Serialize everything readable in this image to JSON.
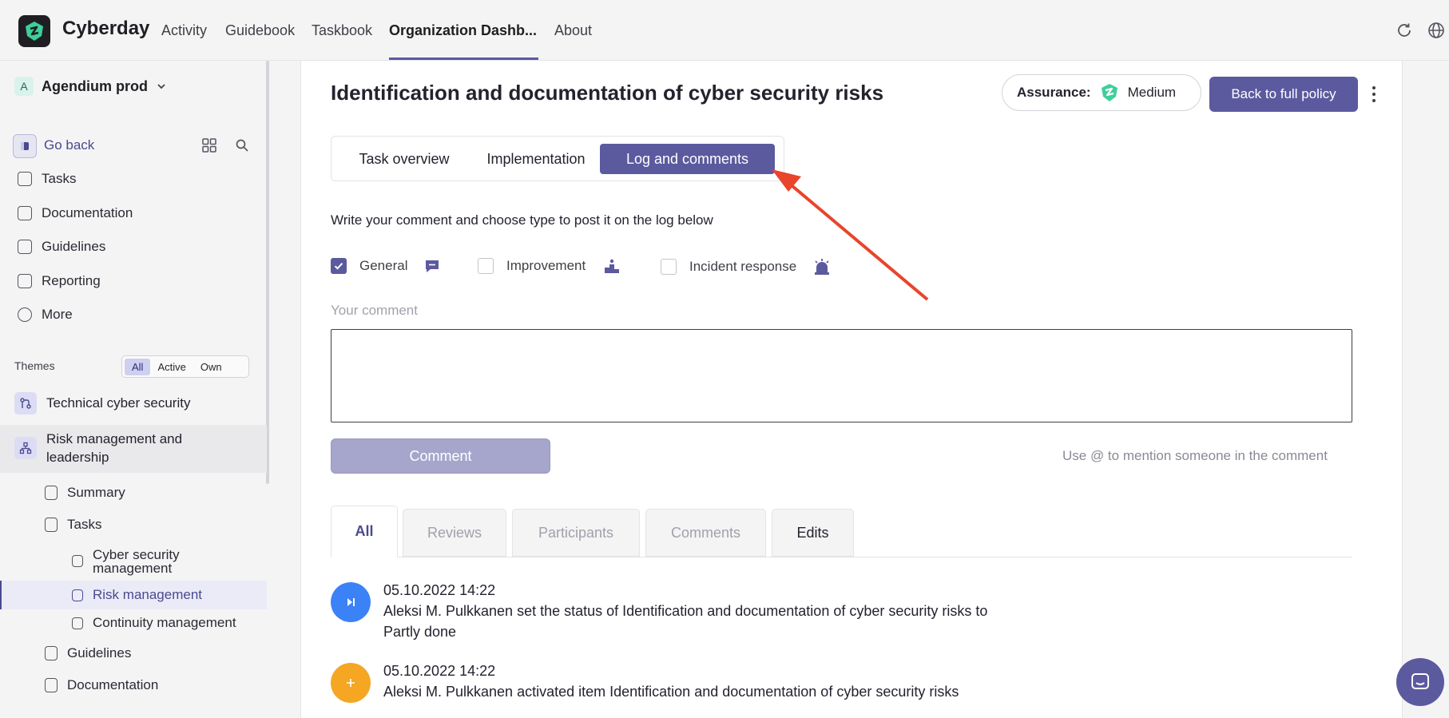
{
  "app": {
    "brand": "Cyberday"
  },
  "nav": {
    "items": [
      {
        "label": "Activity"
      },
      {
        "label": "Guidebook"
      },
      {
        "label": "Taskbook"
      },
      {
        "label": "Organization Dashb..."
      },
      {
        "label": "About"
      }
    ],
    "active_index": 3,
    "right_icons": [
      "refresh-icon",
      "globe-icon"
    ]
  },
  "sidebar": {
    "org_initial": "A",
    "org_name": "Agendium prod",
    "go_back": "Go back",
    "menu": [
      {
        "label": "Tasks",
        "icon": "tasks-icon"
      },
      {
        "label": "Documentation",
        "icon": "document-icon"
      },
      {
        "label": "Guidelines",
        "icon": "clipboard-icon"
      },
      {
        "label": "Reporting",
        "icon": "report-icon"
      },
      {
        "label": "More",
        "icon": "more-icon"
      }
    ],
    "themes_label": "Themes",
    "filters": [
      "All",
      "Active",
      "Own"
    ],
    "active_filter": "All",
    "themes": [
      {
        "label": "Technical cyber security"
      },
      {
        "label": "Risk management and leadership"
      }
    ],
    "sub_items": [
      {
        "label": "Summary"
      },
      {
        "label": "Tasks"
      }
    ],
    "task_items": [
      {
        "label": "Cyber security management"
      },
      {
        "label": "Risk management"
      },
      {
        "label": "Continuity management"
      }
    ],
    "more_sub": [
      {
        "label": "Guidelines"
      },
      {
        "label": "Documentation"
      }
    ]
  },
  "main": {
    "title": "Identification and documentation of cyber security risks",
    "assurance_label": "Assurance:",
    "assurance_value": "Medium",
    "back_button": "Back to full policy",
    "tabs": [
      {
        "label": "Task overview"
      },
      {
        "label": "Implementation"
      },
      {
        "label": "Log and comments"
      }
    ],
    "active_tab": "Log and comments",
    "instructions": "Write your comment and choose type to post it on the log below",
    "comment_types": [
      {
        "label": "General",
        "checked": true,
        "icon": "chat-bubble-icon"
      },
      {
        "label": "Improvement",
        "checked": false,
        "icon": "podium-icon"
      },
      {
        "label": "Incident response",
        "checked": false,
        "icon": "alarm-icon"
      }
    ],
    "comment_label": "Your comment",
    "comment_value": "",
    "comment_button": "Comment",
    "mention_hint": "Use @ to mention someone in the comment",
    "log_tabs": [
      {
        "label": "All"
      },
      {
        "label": "Reviews"
      },
      {
        "label": "Participants"
      },
      {
        "label": "Comments"
      },
      {
        "label": "Edits"
      }
    ],
    "log_entries": [
      {
        "time": "05.10.2022 14:22",
        "text": "Aleksi M. Pulkkanen set the status of Identification and documentation of cyber security risks to Partly done",
        "icon_color": "#3b82f6",
        "icon": "skip-forward-icon"
      },
      {
        "time": "05.10.2022 14:22",
        "text": "Aleksi M. Pulkkanen activated item Identification and documentation of cyber security risks",
        "icon_color": "#f5a623",
        "icon": "plus-icon"
      }
    ]
  },
  "colors": {
    "accent": "#5b5a9f",
    "annotation_arrow": "#e8452c"
  }
}
